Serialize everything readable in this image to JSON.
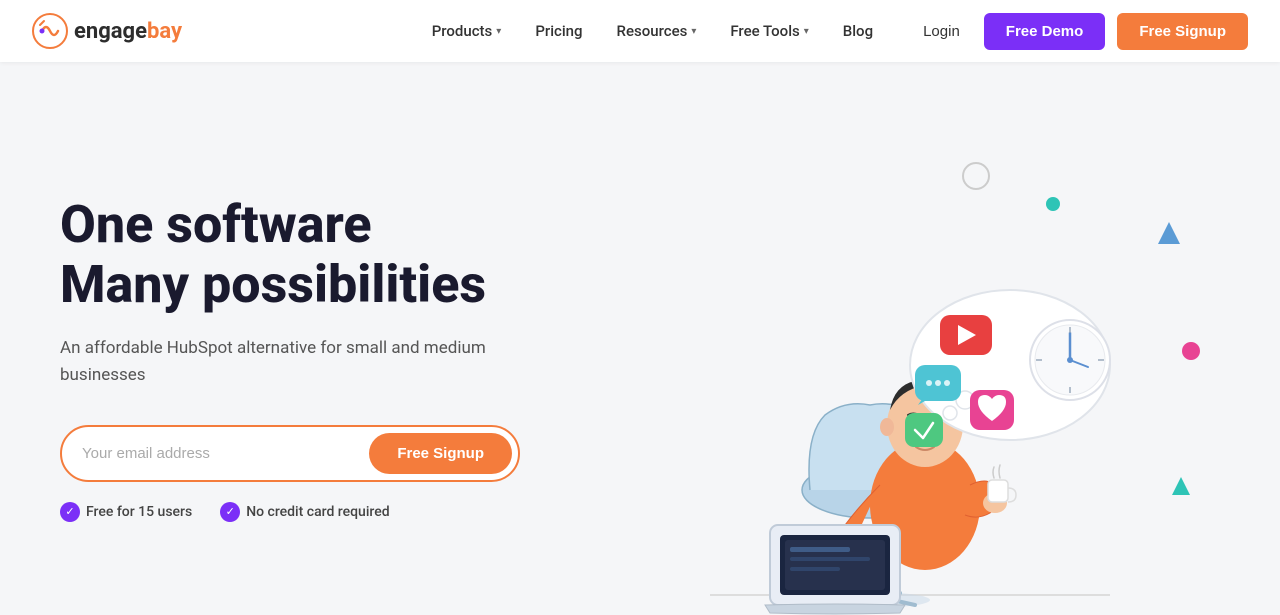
{
  "brand": {
    "name_engage": "engage",
    "name_bay": "bay",
    "full_name": "engagebay"
  },
  "nav": {
    "products_label": "Products",
    "pricing_label": "Pricing",
    "resources_label": "Resources",
    "free_tools_label": "Free Tools",
    "blog_label": "Blog",
    "login_label": "Login",
    "free_demo_label": "Free Demo",
    "free_signup_label": "Free Signup"
  },
  "hero": {
    "title_line1": "One software",
    "title_line2": "Many possibilities",
    "subtitle": "An affordable HubSpot alternative for small and medium businesses",
    "email_placeholder": "Your email address",
    "signup_button": "Free Signup",
    "badge1": "Free for 15 users",
    "badge2": "No credit card required"
  },
  "colors": {
    "purple": "#7b2ff7",
    "orange": "#f47c3c",
    "teal": "#2ec4b6",
    "pink": "#e84393",
    "dark": "#1a1a2e"
  }
}
